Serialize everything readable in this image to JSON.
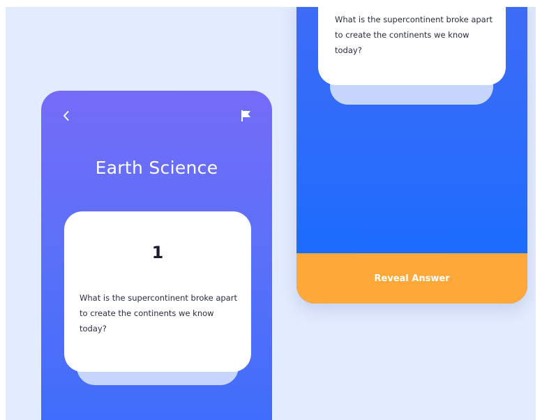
{
  "colors": {
    "background": "#e3ebfe",
    "left_gradient_top": "#756cf8",
    "left_gradient_bottom": "#3d6dfb",
    "right_gradient_top": "#3f6cf6",
    "right_gradient_bottom": "#136bfe",
    "card": "#ffffff",
    "card_stack": "#c6d5fb",
    "reveal_button": "#fea83a"
  },
  "left_screen": {
    "icons": {
      "back": "chevron-left-icon",
      "flag": "flag-icon"
    },
    "title": "Earth Science",
    "card": {
      "number": "1",
      "question": "What is the supercontinent broke apart to create the continents we know today?"
    }
  },
  "right_screen": {
    "card": {
      "question": "What is the supercontinent broke apart to create the continents we know today?"
    },
    "reveal_button": "Reveal Answer"
  }
}
